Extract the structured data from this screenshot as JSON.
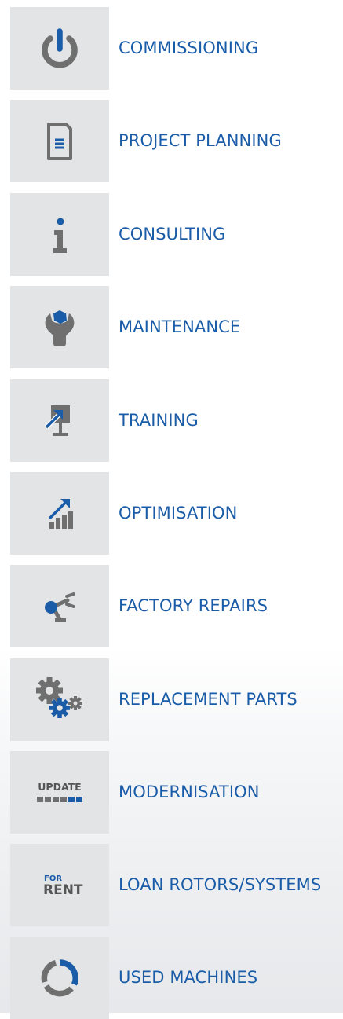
{
  "services": [
    {
      "label": "COMMISSIONING",
      "icon": "power-icon"
    },
    {
      "label": "PROJECT PLANNING",
      "icon": "document-icon"
    },
    {
      "label": "CONSULTING",
      "icon": "info-icon"
    },
    {
      "label": "MAINTENANCE",
      "icon": "wrench-icon"
    },
    {
      "label": "TRAINING",
      "icon": "presentation-icon"
    },
    {
      "label": "OPTIMISATION",
      "icon": "growth-chart-icon"
    },
    {
      "label": "FACTORY REPAIRS",
      "icon": "robot-arm-icon"
    },
    {
      "label": "REPLACEMENT PARTS",
      "icon": "gears-icon"
    },
    {
      "label": "MODERNISATION",
      "icon": "update-icon",
      "icon_text": "UPDATE"
    },
    {
      "label": "LOAN ROTORS/SYSTEMS",
      "icon": "for-rent-icon",
      "icon_text_top": "FOR",
      "icon_text_bottom": "RENT"
    },
    {
      "label": "USED MACHINES",
      "icon": "recycle-icon"
    }
  ],
  "colors": {
    "accent_blue": "#1a5ca8",
    "icon_gray": "#6f6f6f",
    "tile_background": "#e3e4e5"
  }
}
